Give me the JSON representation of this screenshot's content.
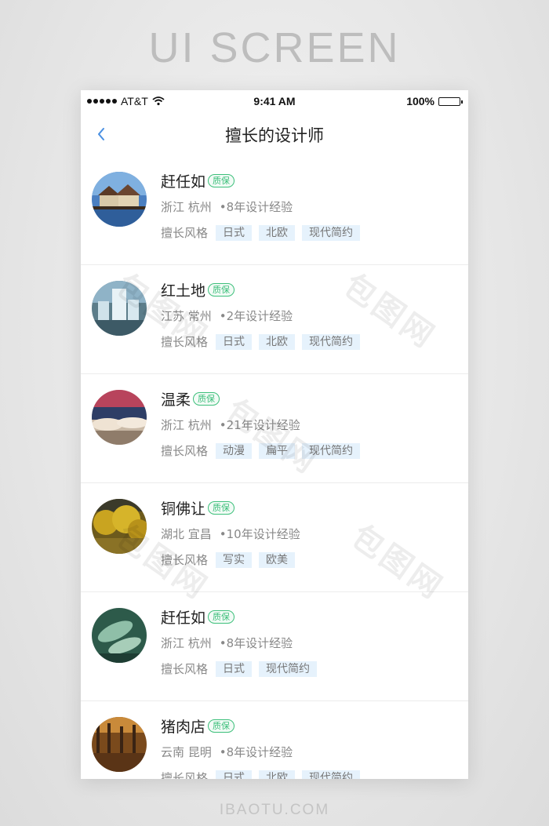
{
  "banner": "UI SCREEN",
  "footer": "IBAOTU.COM",
  "status_bar": {
    "carrier": "AT&T",
    "time": "9:41 AM",
    "battery": "100%"
  },
  "nav": {
    "title": "擅长的设计师",
    "back_icon": "chevron-left-icon"
  },
  "labels": {
    "style_label": "擅长风格",
    "badge": "质保"
  },
  "designers": [
    {
      "name": "赶任如",
      "location": "浙江 杭州",
      "experience": "•8年设计经验",
      "tags": [
        "日式",
        "北欧",
        "现代简约"
      ]
    },
    {
      "name": "红土地",
      "location": "江苏 常州",
      "experience": "•2年设计经验",
      "tags": [
        "日式",
        "北欧",
        "现代简约"
      ]
    },
    {
      "name": "温柔",
      "location": "浙江 杭州",
      "experience": "•21年设计经验",
      "tags": [
        "动漫",
        "扁平",
        "现代简约"
      ]
    },
    {
      "name": "铜佛让",
      "location": "湖北 宜昌",
      "experience": "•10年设计经验",
      "tags": [
        "写实",
        "欧美"
      ]
    },
    {
      "name": "赶任如",
      "location": "浙江 杭州",
      "experience": "•8年设计经验",
      "tags": [
        "日式",
        "现代简约"
      ]
    },
    {
      "name": "猪肉店",
      "location": "云南 昆明",
      "experience": "•8年设计经验",
      "tags": [
        "日式",
        "北欧",
        "现代简约"
      ]
    }
  ],
  "watermark": "包图网",
  "colors": {
    "accent": "#4a90e2",
    "badge": "#3cbf7a",
    "tag_bg": "#e6f2fc"
  }
}
